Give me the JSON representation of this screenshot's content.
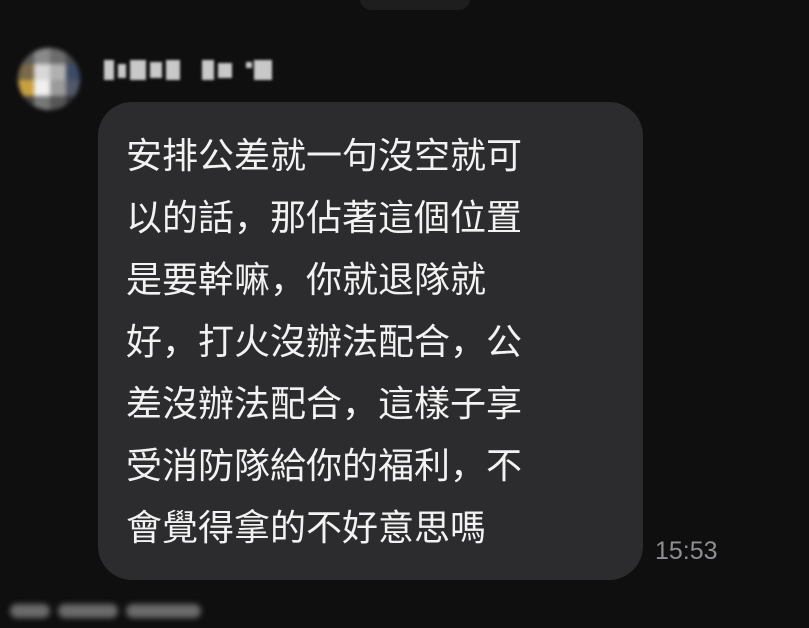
{
  "conversation": {
    "sender": {
      "avatar_icon": "avatar-blurred",
      "name_visible": false
    },
    "message": {
      "lines": [
        "安排公差就一句沒空就可",
        "以的話，那佔著這個位置",
        "是要幹嘛，你就退隊就",
        "好，打火沒辦法配合，公",
        "差沒辦法配合，這樣子享",
        "受消防隊給你的福利，不",
        "會覺得拿的不好意思嗎"
      ],
      "time": "15:53"
    }
  },
  "colors": {
    "background": "#0f0f0f",
    "bubble": "#2c2c2e",
    "text": "#f2f2f2",
    "timestamp": "#8e8e93"
  }
}
